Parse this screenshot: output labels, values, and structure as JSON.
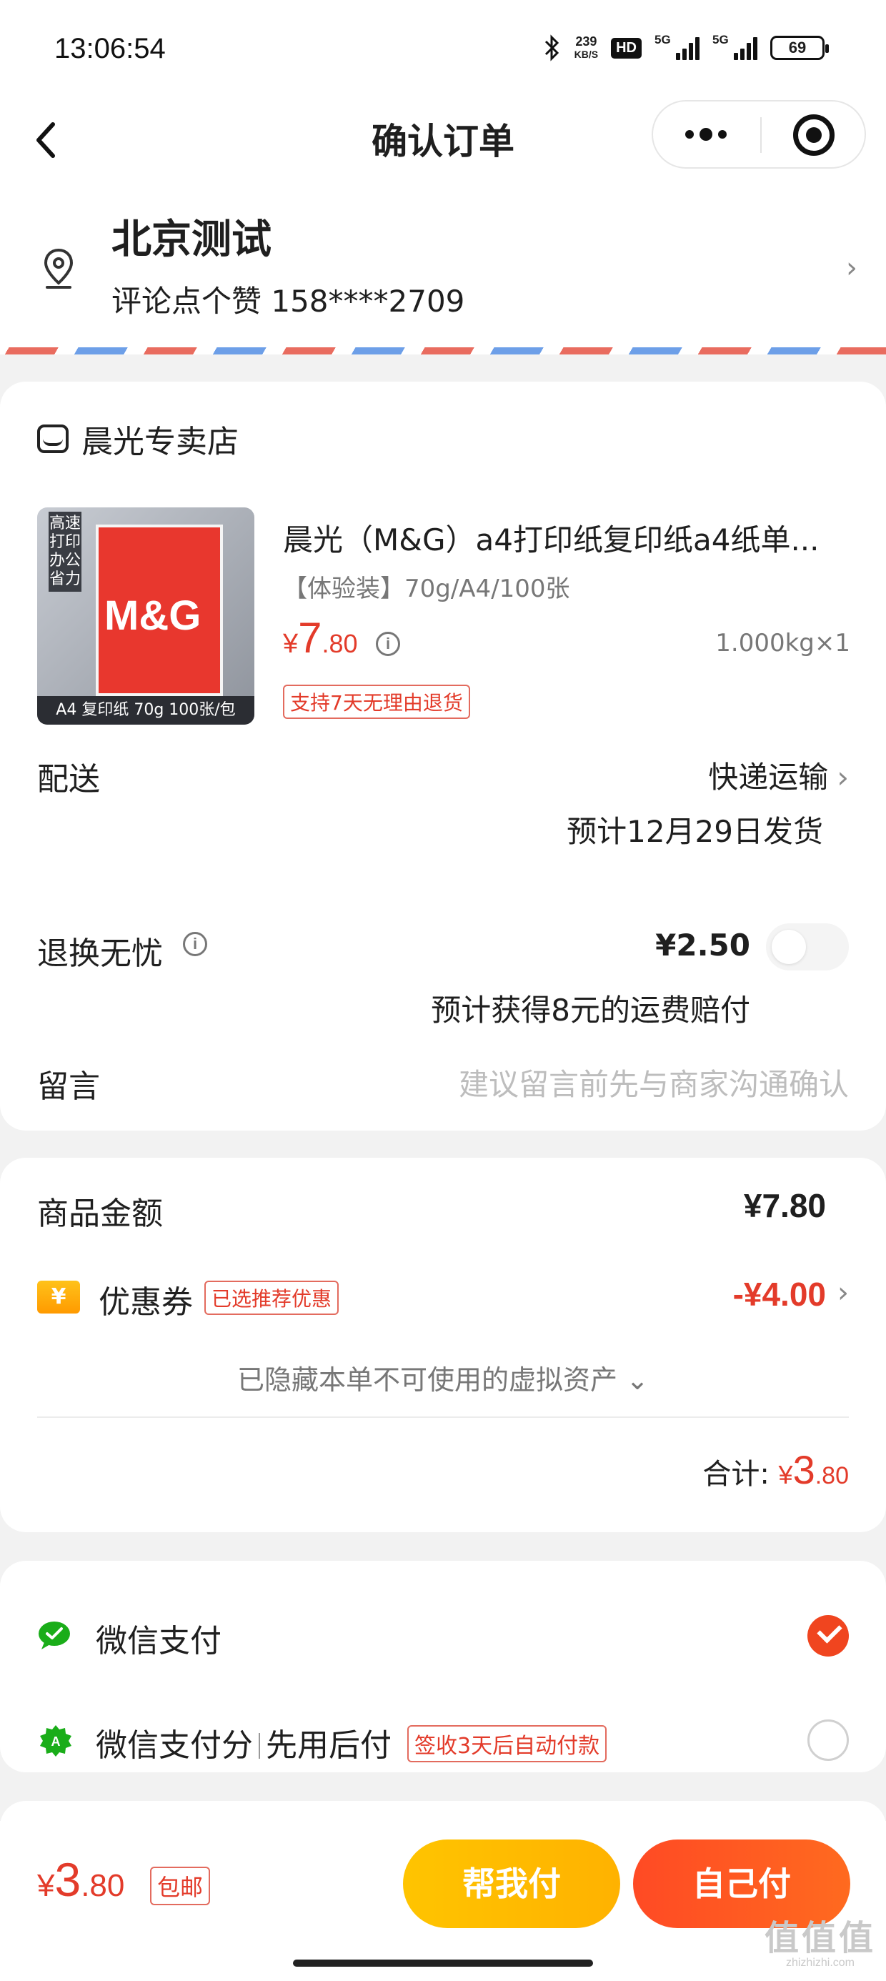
{
  "status_bar": {
    "time": "13:06:54",
    "net_speed_value": "239",
    "net_speed_unit": "KB/S",
    "hd_label": "HD",
    "signal1_label": "5G",
    "signal2_label": "5G",
    "battery": "69"
  },
  "nav": {
    "title": "确认订单",
    "icons": [
      "back-icon",
      "more-icon",
      "close-target-icon"
    ]
  },
  "address": {
    "name": "北京测试",
    "contact": "评论点个赞 158****2709",
    "icons": [
      "location-pin-icon",
      "chevron-right-icon"
    ]
  },
  "shop": {
    "name": "晨光专卖店",
    "product": {
      "title": "晨光（M&G）a4打印纸复印纸a4纸单...",
      "spec": "【体验装】70g/A4/100张",
      "price_currency": "¥",
      "price_int": "7",
      "price_dec": ".80",
      "weight_qty": "1.000kg×1",
      "badge": "支持7天无理由退货",
      "image": {
        "brand": "M&G",
        "side_text": "高速打印 办公省力",
        "caption": "A4 复印纸 70g 100张/包"
      }
    },
    "delivery": {
      "label": "配送",
      "method": "快递运输",
      "estimate": "预计12月29日发货"
    },
    "return_insurance": {
      "label": "退换无忧",
      "price": "¥2.50",
      "note": "预计获得8元的运费赔付",
      "enabled": false
    },
    "message": {
      "label": "留言",
      "placeholder": "建议留言前先与商家沟通确认"
    }
  },
  "amount": {
    "goods_label": "商品金额",
    "goods_value": "¥7.80",
    "coupon_icon_text": "¥",
    "coupon_label": "优惠券",
    "coupon_badge": "已选推荐优惠",
    "coupon_value": "-¥4.00",
    "hidden_note": "已隐藏本单不可使用的虚拟资产",
    "total_label": "合计:",
    "total_currency": "¥",
    "total_int": "3",
    "total_dec": ".80"
  },
  "payment": {
    "options": [
      {
        "label": "微信支付",
        "selected": true,
        "icon": "wechat-pay-icon"
      },
      {
        "label_a": "微信支付分",
        "label_b": "先用后付",
        "badge": "签收3天后自动付款",
        "selected": false,
        "icon": "wechat-score-icon"
      }
    ]
  },
  "bottom": {
    "price_currency": "¥",
    "price_int": "3",
    "price_dec": ".80",
    "shipping_badge": "包邮",
    "help_pay_label": "帮我付",
    "self_pay_label": "自己付"
  },
  "watermark": {
    "text": "值值值",
    "domain": "zhizhizhi.com"
  },
  "colors": {
    "accent_red": "#e33b2a",
    "help_button": "#ffbb00",
    "self_button": "#ff5322",
    "wechat_green": "#1aad19"
  }
}
